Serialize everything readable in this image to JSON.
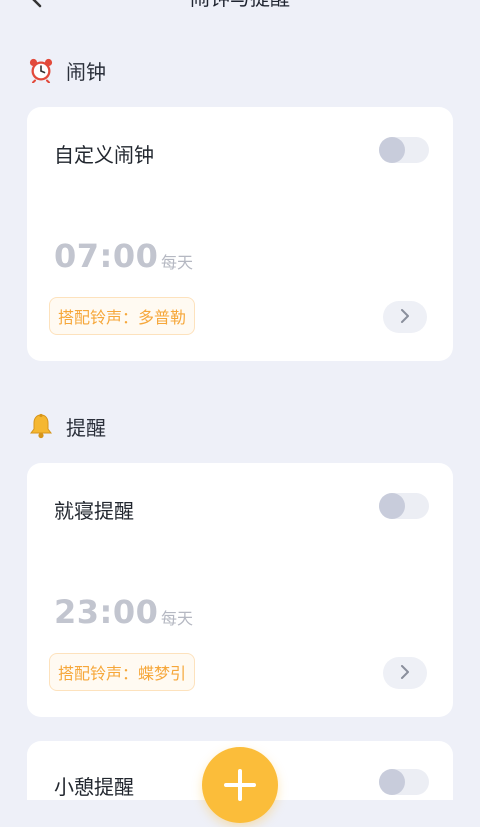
{
  "header": {
    "title": "闹钟与提醒"
  },
  "sections": {
    "alarm": {
      "icon": "alarm-clock-icon",
      "title": "闹钟"
    },
    "reminder": {
      "icon": "bell-icon",
      "title": "提醒"
    }
  },
  "cards": {
    "custom_alarm": {
      "title": "自定义闹钟",
      "time": "07:00",
      "repeat": "每天",
      "ringtone": "搭配铃声：多普勒",
      "enabled": false
    },
    "bedtime": {
      "title": "就寝提醒",
      "time": "23:00",
      "repeat": "每天",
      "ringtone": "搭配铃声：蝶梦引",
      "enabled": false
    },
    "break": {
      "title": "小憩提醒",
      "enabled": false
    }
  },
  "colors": {
    "background": "#eef0f8",
    "card": "#ffffff",
    "accent": "#fbbd3a",
    "ringtone_text": "#f6a73a",
    "toggle_off": "#c8ccdb"
  }
}
